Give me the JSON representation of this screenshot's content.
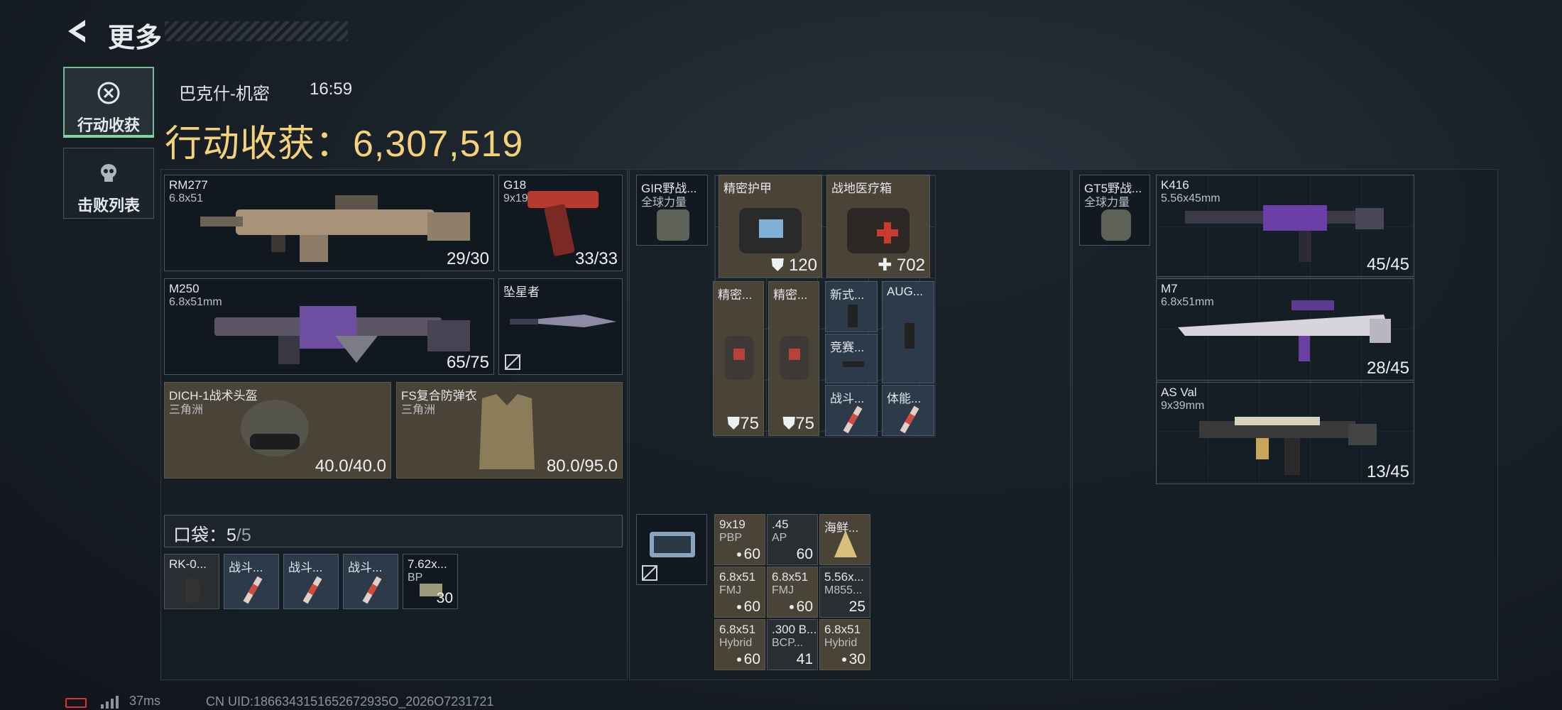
{
  "header": {
    "title": "更多"
  },
  "tabs": [
    {
      "label": "行动收获",
      "icon": "loot-coin-icon",
      "active": true
    },
    {
      "label": "击败列表",
      "icon": "skull-icon",
      "active": false
    }
  ],
  "raid": {
    "map": "巴克什-机密",
    "time": "16:59",
    "loot_label": "行动收获：6,307,519"
  },
  "colors": {
    "accent_green": "#7fd4a0",
    "gold": "#f3d27a"
  },
  "loadout": {
    "rm277": {
      "name": "RM277",
      "sub": "6.8x51",
      "count": "29/30"
    },
    "g18": {
      "name": "G18",
      "sub": "9x19mm",
      "count": "33/33"
    },
    "m250": {
      "name": "M250",
      "sub": "6.8x51mm",
      "count": "65/75"
    },
    "melee": {
      "name": "坠星者"
    },
    "helmet": {
      "name": "DICH-1战术头盔",
      "sub": "三角洲",
      "count": "40.0/40.0"
    },
    "armor": {
      "name": "FS复合防弹衣",
      "sub": "三角洲",
      "count": "80.0/95.0"
    }
  },
  "pocket": {
    "label": "口袋：",
    "count": "5",
    "total": "/5",
    "items": [
      {
        "name": "RK-0..."
      },
      {
        "name": "战斗..."
      },
      {
        "name": "战斗..."
      },
      {
        "name": "战斗..."
      },
      {
        "name": "7.62x...",
        "sub": "BP",
        "count": "30"
      }
    ]
  },
  "chest_rig": {
    "name": "GIR野战...",
    "sub": "全球力量",
    "items": [
      {
        "name": "精密护甲",
        "count": "120"
      },
      {
        "name": "战地医疗箱",
        "count": "702"
      },
      {
        "name": "精密...",
        "count": "75"
      },
      {
        "name": "精密...",
        "count": "75"
      },
      {
        "name": "新式..."
      },
      {
        "name": "AUG..."
      },
      {
        "name": "竞赛..."
      },
      {
        "name": "战斗..."
      },
      {
        "name": "体能..."
      }
    ]
  },
  "safe_box": {
    "ammo": [
      {
        "name": "9x19",
        "sub": "PBP",
        "count": "60"
      },
      {
        "name": ".45",
        "sub": "AP",
        "count": "60"
      },
      {
        "name": "海鲜..."
      },
      {
        "name": "6.8x51",
        "sub": "FMJ",
        "count": "60"
      },
      {
        "name": "6.8x51",
        "sub": "FMJ",
        "count": "60"
      },
      {
        "name": "5.56x...",
        "sub": "M855...",
        "count": "25"
      },
      {
        "name": "6.8x51",
        "sub": "Hybrid",
        "count": "60"
      },
      {
        "name": ".300 B...",
        "sub": "BCP...",
        "count": "41"
      },
      {
        "name": "6.8x51",
        "sub": "Hybrid",
        "count": "30"
      }
    ]
  },
  "backpack": {
    "name": "GT5野战...",
    "sub": "全球力量",
    "weapons": [
      {
        "name": "K416",
        "sub": "5.56x45mm",
        "count": "45/45"
      },
      {
        "name": "M7",
        "sub": "6.8x51mm",
        "count": "28/45"
      },
      {
        "name": "AS Val",
        "sub": "9x39mm",
        "count": "13/45"
      }
    ]
  },
  "status": {
    "ping": "37ms",
    "uid": "CN UID:1866343151652672935O_2026O7231721"
  }
}
